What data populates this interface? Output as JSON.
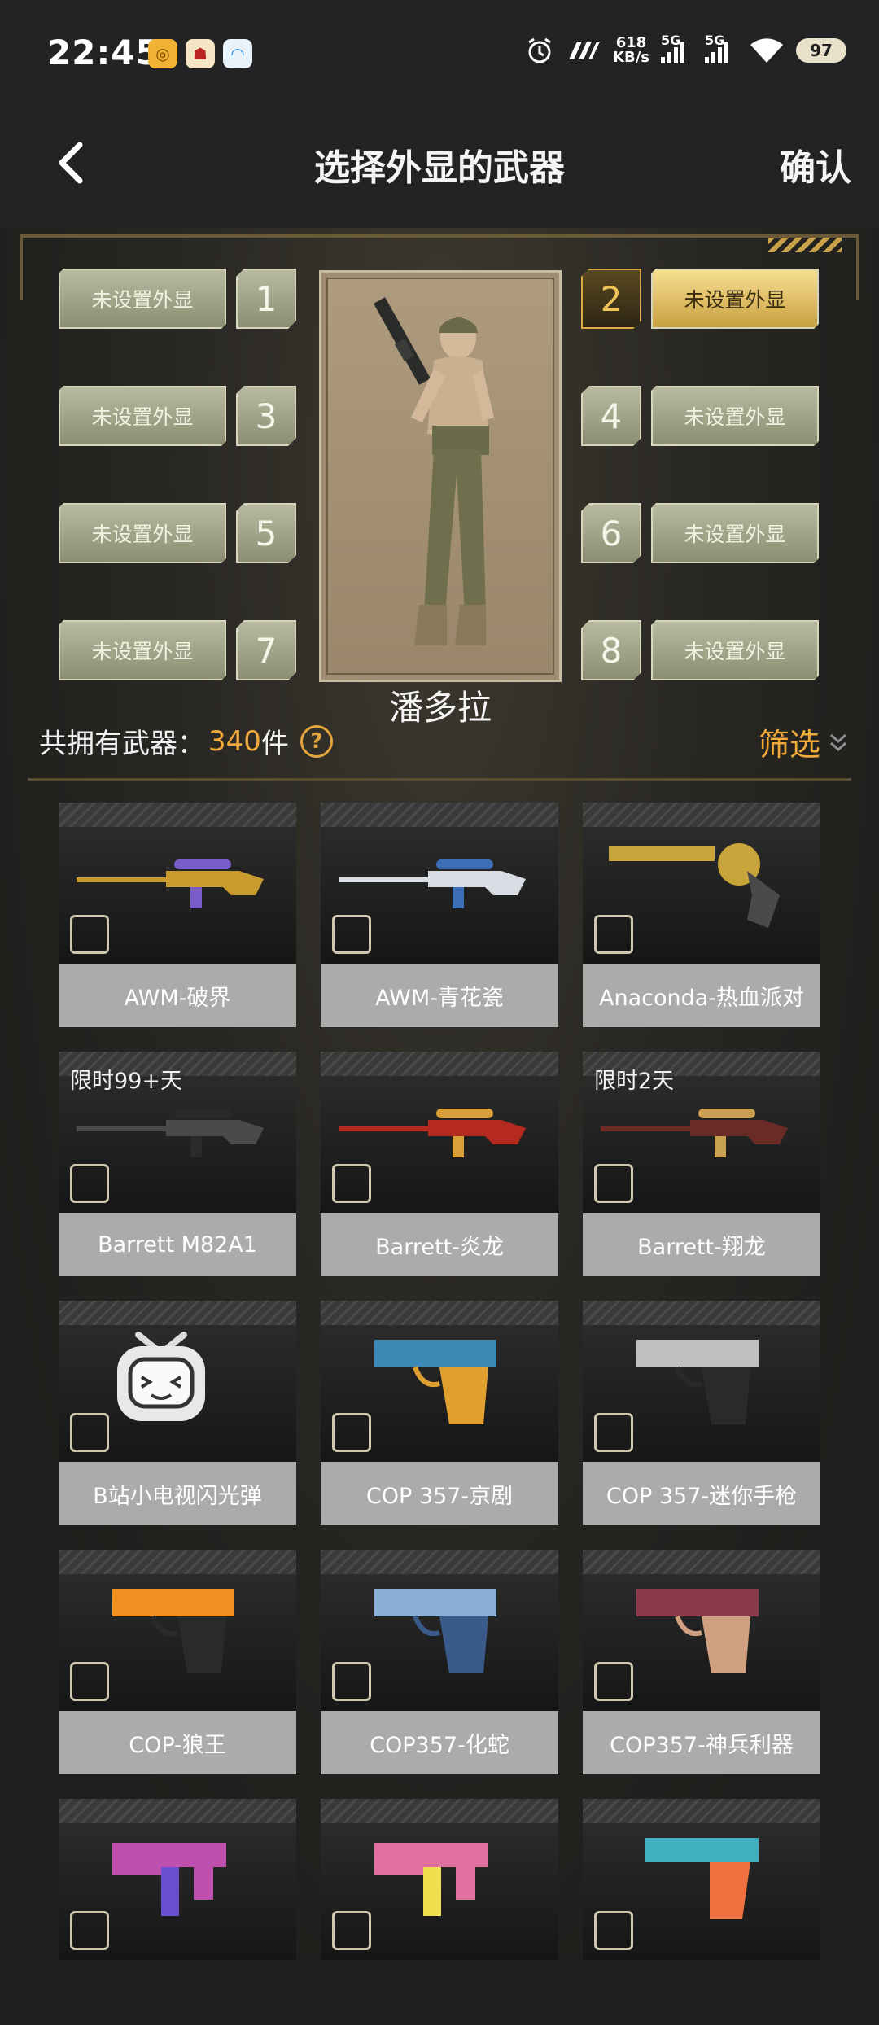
{
  "status_bar": {
    "time": "22:45",
    "net_speed_value": "618",
    "net_speed_unit": "KB/s",
    "sig1": "5G",
    "sig2": "5G",
    "battery": "97"
  },
  "header": {
    "title": "选择外显的武器",
    "confirm": "确认"
  },
  "slots": [
    {
      "num": "1",
      "label": "未设置外显",
      "active": false
    },
    {
      "num": "2",
      "label": "未设置外显",
      "active": true
    },
    {
      "num": "3",
      "label": "未设置外显",
      "active": false
    },
    {
      "num": "4",
      "label": "未设置外显",
      "active": false
    },
    {
      "num": "5",
      "label": "未设置外显",
      "active": false
    },
    {
      "num": "6",
      "label": "未设置外显",
      "active": false
    },
    {
      "num": "7",
      "label": "未设置外显",
      "active": false
    },
    {
      "num": "8",
      "label": "未设置外显",
      "active": false
    }
  ],
  "character": {
    "name": "潘多拉"
  },
  "summary": {
    "owned_label": "共拥有武器：",
    "owned_count": "340",
    "owned_unit": "件",
    "help_icon": "?",
    "filter": "筛选",
    "filter_icon": "chevrons-down-icon"
  },
  "weapons": [
    {
      "name": "AWM-破界",
      "badge": "",
      "kind": "sniper",
      "color": "#c99a2e",
      "accent": "#7a5cc9"
    },
    {
      "name": "AWM-青花瓷",
      "badge": "",
      "kind": "sniper",
      "color": "#d8dde4",
      "accent": "#3c6fb5"
    },
    {
      "name": "Anaconda-热血派对",
      "badge": "",
      "kind": "revolver",
      "color": "#c8a43a",
      "accent": "#4a4a4a"
    },
    {
      "name": "Barrett M82A1",
      "badge": "限时99+天",
      "kind": "sniper",
      "color": "#4a4a4a",
      "accent": "#2a2a2a"
    },
    {
      "name": "Barrett-炎龙",
      "badge": "",
      "kind": "sniper",
      "color": "#b52a20",
      "accent": "#d9a03a"
    },
    {
      "name": "Barrett-翔龙",
      "badge": "限时2天",
      "kind": "sniper",
      "color": "#6a2a26",
      "accent": "#c8a050"
    },
    {
      "name": "B站小电视闪光弹",
      "badge": "",
      "kind": "tv",
      "color": "#e8e8e8",
      "accent": "#333333"
    },
    {
      "name": "COP 357-京剧",
      "badge": "",
      "kind": "pistol",
      "color": "#3a8ab5",
      "accent": "#e0a030"
    },
    {
      "name": "COP 357-迷你手枪",
      "badge": "",
      "kind": "pistol",
      "color": "#c0c0c0",
      "accent": "#2a2a2a"
    },
    {
      "name": "COP-狼王",
      "badge": "",
      "kind": "pistol",
      "color": "#f09020",
      "accent": "#2a2a2a"
    },
    {
      "name": "COP357-化蛇",
      "badge": "",
      "kind": "pistol",
      "color": "#8ab0d8",
      "accent": "#3a5a8a"
    },
    {
      "name": "COP357-神兵利器",
      "badge": "",
      "kind": "pistol",
      "color": "#8a3a4a",
      "accent": "#d0a080"
    },
    {
      "name": "",
      "badge": "",
      "kind": "smg",
      "color": "#c050b0",
      "accent": "#6a50d0"
    },
    {
      "name": "",
      "badge": "",
      "kind": "smg",
      "color": "#e070a0",
      "accent": "#f0e050"
    },
    {
      "name": "",
      "badge": "",
      "kind": "pistol2",
      "color": "#40b0c0",
      "accent": "#f07040"
    }
  ]
}
